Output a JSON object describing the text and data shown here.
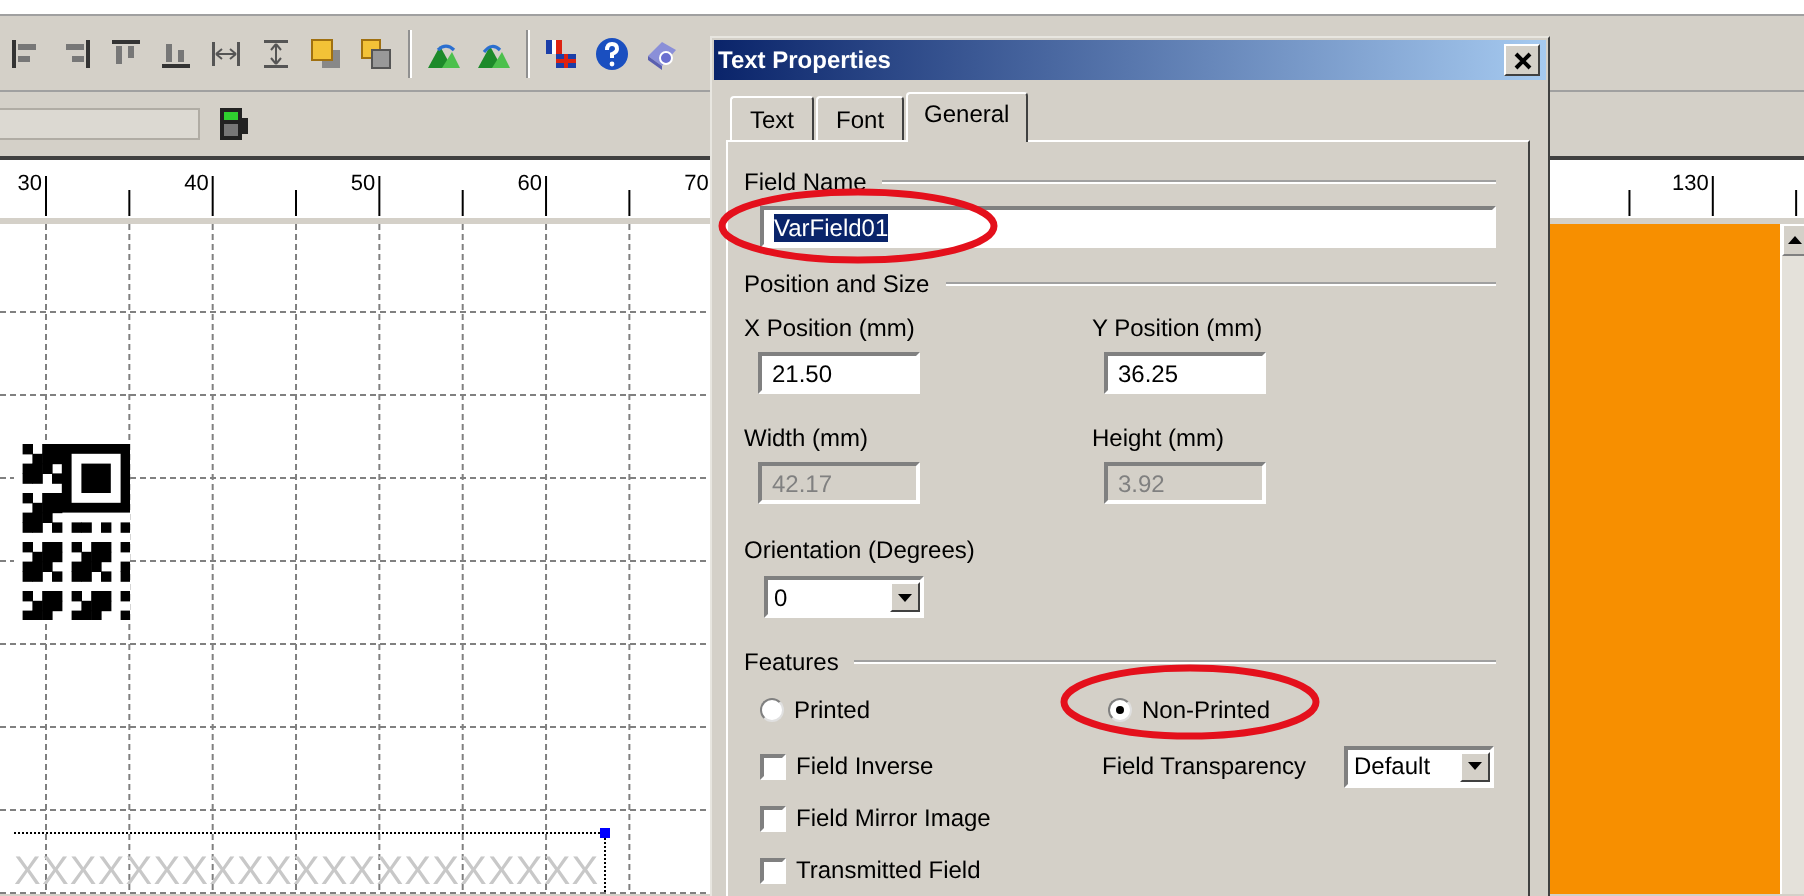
{
  "ruler": {
    "left_labels": [
      "30",
      "40",
      "50",
      "60",
      "70"
    ],
    "right_labels": [
      "130"
    ]
  },
  "canvas": {
    "placeholder_text": "XXXXXXXXXXXXXXXXXXXXX"
  },
  "dialog": {
    "title": "Text Properties",
    "tabs": [
      {
        "label": "Text",
        "selected": false
      },
      {
        "label": "Font",
        "selected": false
      },
      {
        "label": "General",
        "selected": true
      }
    ],
    "field_name": {
      "label": "Field Name",
      "value": "VarField01",
      "text_selected": true
    },
    "position_section": "Position and Size",
    "fields": [
      {
        "label": "X Position (mm)",
        "value": "21.50",
        "disabled": false
      },
      {
        "label": "Y Position (mm)",
        "value": "36.25",
        "disabled": false
      },
      {
        "label": "Width (mm)",
        "value": "42.17",
        "disabled": true
      },
      {
        "label": "Height (mm)",
        "value": "3.92",
        "disabled": true
      }
    ],
    "orientation": {
      "label": "Orientation (Degrees)",
      "value": "0"
    },
    "features_section": "Features",
    "print_options": [
      {
        "label": "Printed",
        "selected": false
      },
      {
        "label": "Non-Printed",
        "selected": true
      }
    ],
    "checkboxes": [
      {
        "label": "Field Inverse",
        "checked": false
      },
      {
        "label": "Field Mirror Image",
        "checked": false
      },
      {
        "label": "Transmitted Field",
        "checked": false
      }
    ],
    "transparency": {
      "label": "Field Transparency",
      "value": "Default"
    }
  }
}
